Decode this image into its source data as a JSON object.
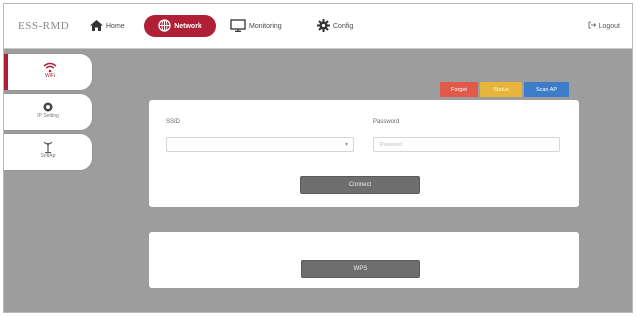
{
  "header": {
    "brand": "ESS-RMD",
    "nav": {
      "home": "Home",
      "network": "Network",
      "monitoring": "Monitoring",
      "config": "Config"
    },
    "logout": "Logout"
  },
  "sidebar": {
    "items": [
      {
        "label": "WiFi",
        "icon": "wifi-icon",
        "active": true
      },
      {
        "label": "IP Setting",
        "icon": "gear-icon",
        "active": false
      },
      {
        "label": "SoftAp",
        "icon": "antenna-icon",
        "active": false
      }
    ]
  },
  "actions": {
    "forget": "Forget",
    "status": "Status",
    "scan_ap": "Scan AP"
  },
  "wifi_form": {
    "ssid_label": "SSID",
    "ssid_value": "",
    "password_label": "Password",
    "password_placeholder": "Password",
    "connect_label": "Connect"
  },
  "wps": {
    "button_label": "WPS"
  },
  "colors": {
    "accent": "#b01f35",
    "forget": "#e05a4c",
    "status": "#e7b53a",
    "scan": "#3d7cc9"
  }
}
